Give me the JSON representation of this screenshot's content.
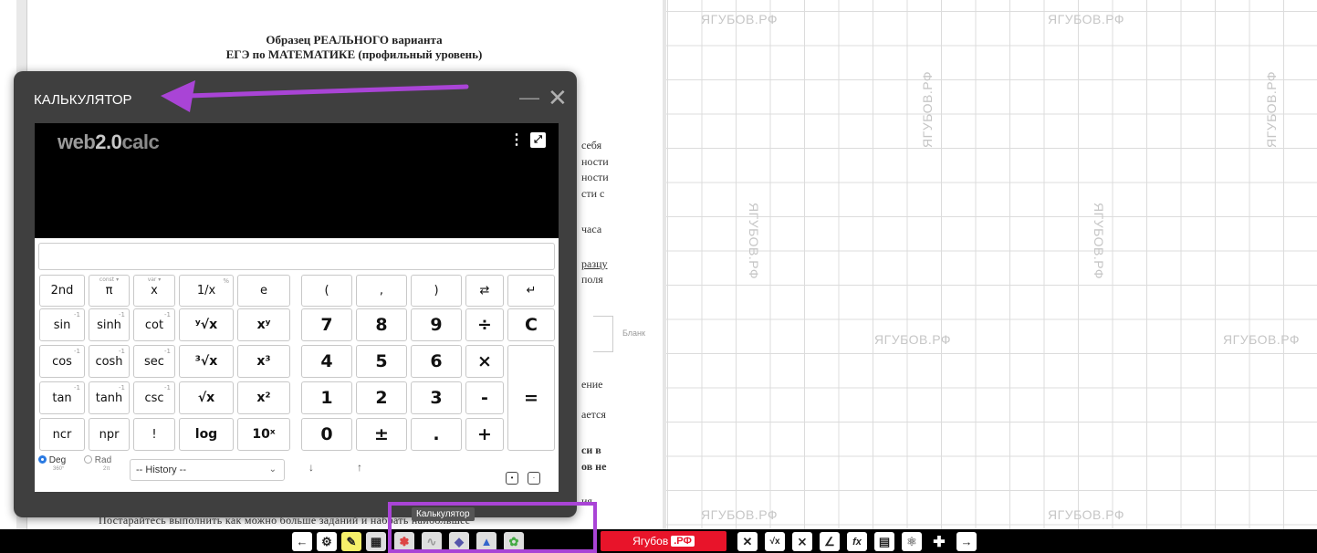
{
  "document": {
    "title_line1": "Образец РЕАЛЬНОГО варианта",
    "title_line2": "ЕГЭ по МАТЕМАТИКЕ (профильный уровень)",
    "fragments": [
      "себя",
      "ности",
      "ности",
      "сти с",
      "часа",
      "разцу",
      "поля",
      "ение",
      "ается",
      "си в",
      "ов не",
      "ия.",
      "Постарайтесь  выполнить  как  можно  больше  заданий  и  набрать  наибольшее"
    ],
    "blank_label": "Бланк"
  },
  "grid": {
    "watermark": "ЯГУБОВ.РФ"
  },
  "calculator": {
    "title": "КАЛЬКУЛЯТОР",
    "minimize": "—",
    "close": "✕",
    "logo_a": "web",
    "logo_b": "2.0",
    "logo_c": "calc",
    "menu_icon": "⋮",
    "expand_icon": "⤢",
    "input_value": "",
    "keys": {
      "k2nd": "2nd",
      "pi": "π",
      "x": "x",
      "inv": "1/x",
      "e": "e",
      "lpar": "(",
      "comma": ",",
      "rpar": ")",
      "swap": "⇄",
      "back": "↵",
      "sin": "sin",
      "sinh": "sinh",
      "cot": "cot",
      "yroot": "ʸ√x",
      "xy": "xʸ",
      "n7": "7",
      "n8": "8",
      "n9": "9",
      "div": "÷",
      "clear": "C",
      "cos": "cos",
      "cosh": "cosh",
      "sec": "sec",
      "croot": "³√x",
      "x3": "x³",
      "n4": "4",
      "n5": "5",
      "n6": "6",
      "mul": "×",
      "tan": "tan",
      "tanh": "tanh",
      "csc": "csc",
      "sqrt": "√x",
      "x2": "x²",
      "n1": "1",
      "n2": "2",
      "n3": "3",
      "sub": "-",
      "eq": "=",
      "ncr": "ncr",
      "npr": "npr",
      "fact": "!",
      "log": "log",
      "tenx": "10ˣ",
      "n0": "0",
      "pm": "±",
      "dot": ".",
      "add": "+"
    },
    "key_super": {
      "inv": "%",
      "sup_neg1": "-1",
      "pi_tiny": "const ▾",
      "x_tiny": "var ▾"
    },
    "deg_label": "Deg",
    "deg_sub": "360°",
    "rad_label": "Rad",
    "rad_sub": "2π",
    "history_label": "-- History --",
    "history_chevron": "⌄",
    "arrow_down": "↓",
    "arrow_up": "↑"
  },
  "tooltip": "Калькулятор",
  "toolbar": {
    "brand": "Ягубов",
    "brand_suffix": ".РФ",
    "left_icons": [
      "←",
      "⚙",
      "✎",
      "▦",
      "✽",
      "∿",
      "◆",
      "▲",
      "✿"
    ],
    "right_icons": [
      "✕",
      "√x",
      "⨯",
      "∠",
      "fx",
      "▤",
      "⚛",
      "✚",
      "→"
    ]
  },
  "colors": {
    "annotation": "#a944d6",
    "brand": "#e8142a",
    "calc_frame": "#3f3f3f",
    "radio": "#2a7ae2"
  }
}
